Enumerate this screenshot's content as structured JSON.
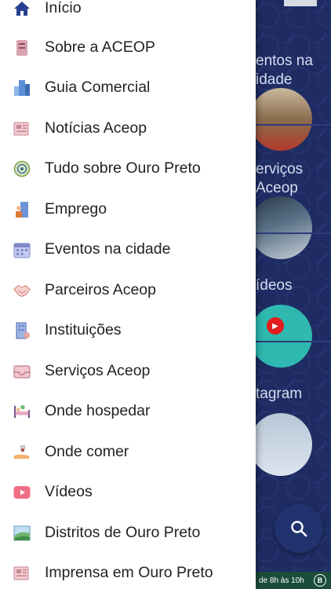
{
  "drawer": {
    "items": [
      {
        "label": "Início",
        "icon": "home-icon"
      },
      {
        "label": "Sobre a ACEOP",
        "icon": "notebook-icon"
      },
      {
        "label": "Guia Comercial",
        "icon": "buildings-icon"
      },
      {
        "label": "Notícias Aceop",
        "icon": "newspaper-icon"
      },
      {
        "label": "Tudo sobre Ouro Preto",
        "icon": "compass-icon"
      },
      {
        "label": "Emprego",
        "icon": "worker-icon"
      },
      {
        "label": "Eventos na cidade",
        "icon": "calendar-icon"
      },
      {
        "label": "Parceiros Aceop",
        "icon": "handshake-icon"
      },
      {
        "label": "Instituições",
        "icon": "institution-icon"
      },
      {
        "label": "Serviços Aceop",
        "icon": "inbox-icon"
      },
      {
        "label": "Onde hospedar",
        "icon": "bed-icon"
      },
      {
        "label": "Onde comer",
        "icon": "dining-icon"
      },
      {
        "label": "Vídeos",
        "icon": "youtube-icon"
      },
      {
        "label": "Distritos de Ouro Preto",
        "icon": "landscape-icon"
      },
      {
        "label": "Imprensa em Ouro Preto",
        "icon": "press-icon"
      }
    ]
  },
  "background": {
    "cards": [
      {
        "line1": "entos na",
        "line2": "idade"
      },
      {
        "line1": "erviços",
        "line2": "Aceop"
      },
      {
        "line1": "ídeos",
        "line2": ""
      },
      {
        "line1": "tagram",
        "line2": ""
      }
    ],
    "bottom_bar_text": "de 8h às 10h",
    "bottom_bar_icon": "B"
  },
  "colors": {
    "background_navy": "#1e2c63",
    "drawer_bg": "#ffffff",
    "home_icon": "#26418f",
    "youtube_red": "#e31d1d"
  }
}
